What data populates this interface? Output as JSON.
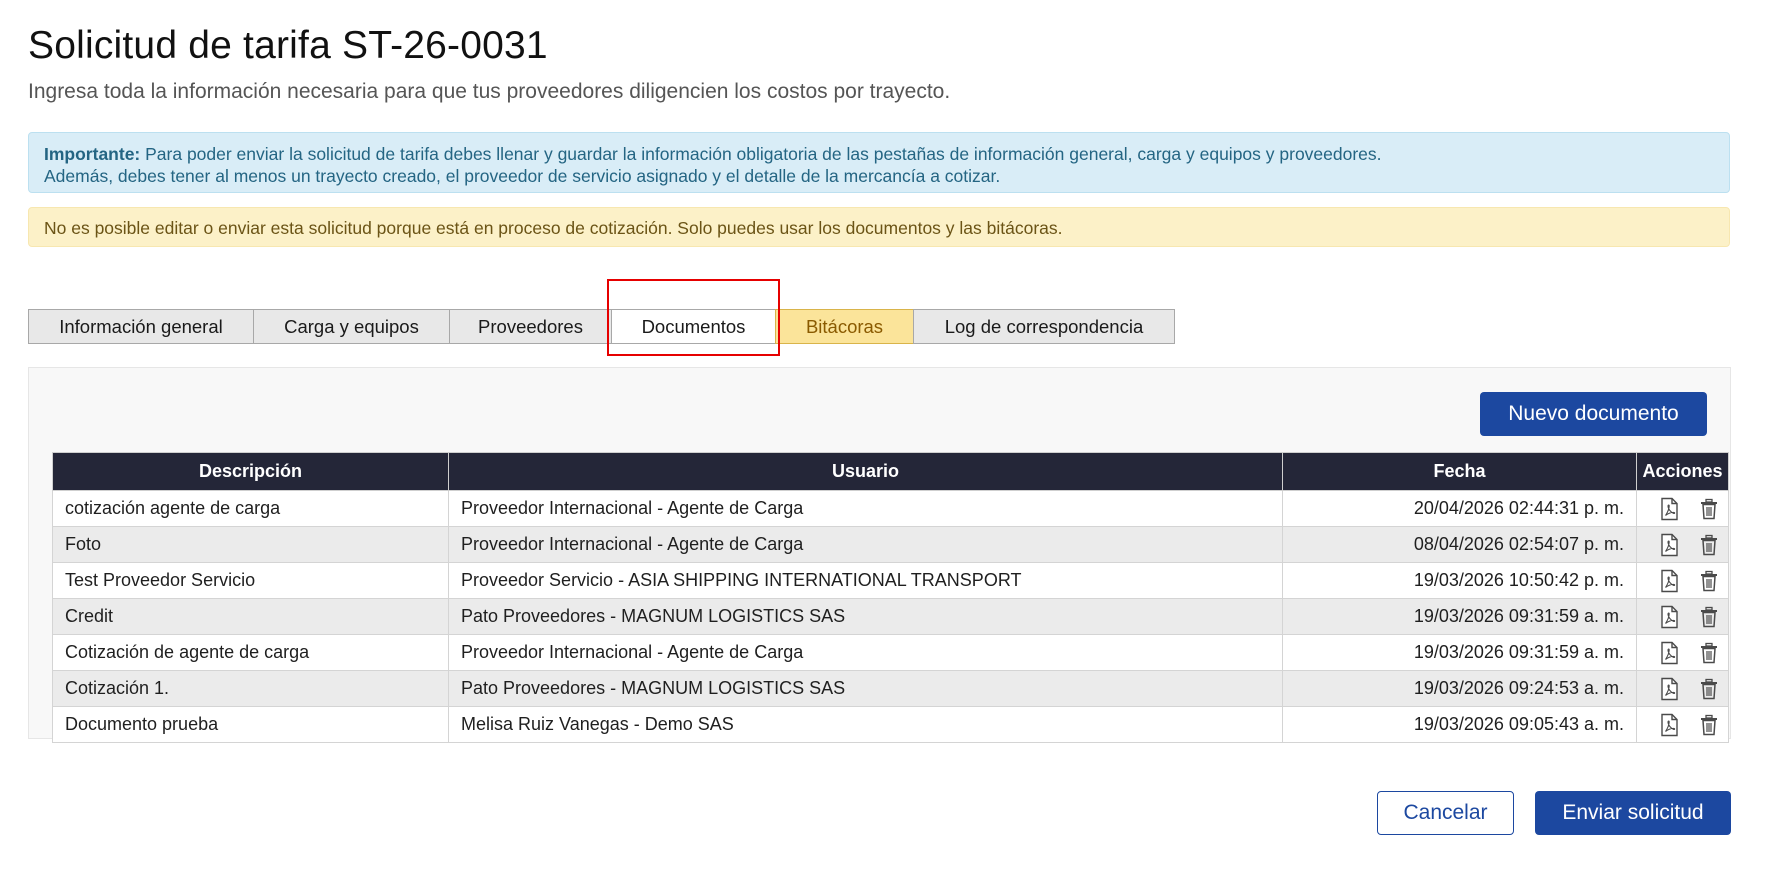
{
  "page": {
    "title": "Solicitud de tarifa ST-26-0031",
    "subtitle": "Ingresa toda la información necesaria para que tus proveedores diligencien los costos por trayecto."
  },
  "alerts": {
    "info_label": "Importante:",
    "info_line1": " Para poder enviar la solicitud de tarifa debes llenar y guardar la información obligatoria de las pestañas de información general, carga y equipos y proveedores.",
    "info_line2": "Además, debes tener al menos un trayecto creado, el proveedor de servicio asignado y el detalle de la mercancía a cotizar.",
    "warning": "No es posible editar o enviar esta solicitud porque está en proceso de cotización. Solo puedes usar los documentos y las bitácoras."
  },
  "tabs": [
    {
      "label": "Información general"
    },
    {
      "label": "Carga y equipos"
    },
    {
      "label": "Proveedores"
    },
    {
      "label": "Documentos"
    },
    {
      "label": "Bitácoras"
    },
    {
      "label": "Log de correspondencia"
    }
  ],
  "active_tab": "Documentos",
  "documents": {
    "new_button": "Nuevo documento",
    "columns": {
      "descripcion": "Descripción",
      "usuario": "Usuario",
      "fecha": "Fecha",
      "acciones": "Acciones"
    },
    "rows": [
      {
        "descripcion": "cotización agente de carga",
        "usuario": "Proveedor Internacional - Agente de Carga",
        "fecha": "20/04/2026 02:44:31 p. m."
      },
      {
        "descripcion": "Foto",
        "usuario": "Proveedor Internacional - Agente de Carga",
        "fecha": "08/04/2026 02:54:07 p. m."
      },
      {
        "descripcion": "Test Proveedor Servicio",
        "usuario": "Proveedor Servicio - ASIA SHIPPING INTERNATIONAL TRANSPORT",
        "fecha": "19/03/2026 10:50:42 p. m."
      },
      {
        "descripcion": "Credit",
        "usuario": "Pato Proveedores - MAGNUM LOGISTICS SAS",
        "fecha": "19/03/2026 09:31:59 a. m."
      },
      {
        "descripcion": "Cotización de agente de carga",
        "usuario": "Proveedor Internacional - Agente de Carga",
        "fecha": "19/03/2026 09:31:59 a. m."
      },
      {
        "descripcion": "Cotización 1.",
        "usuario": "Pato Proveedores - MAGNUM LOGISTICS SAS",
        "fecha": "19/03/2026 09:24:53 a. m."
      },
      {
        "descripcion": "Documento prueba",
        "usuario": "Melisa Ruiz Vanegas - Demo SAS",
        "fecha": "19/03/2026 09:05:43 a. m."
      }
    ],
    "row_icons": [
      "pdf-icon",
      "trash-icon"
    ]
  },
  "footer": {
    "cancel_label": "Cancelar",
    "send_label": "Enviar solicitud"
  },
  "colors": {
    "primary": "#1c48a0",
    "table_header": "#242638",
    "info_bg": "#d9edf7",
    "warning_bg": "#fcf1c8",
    "highlight": "#e60000"
  }
}
